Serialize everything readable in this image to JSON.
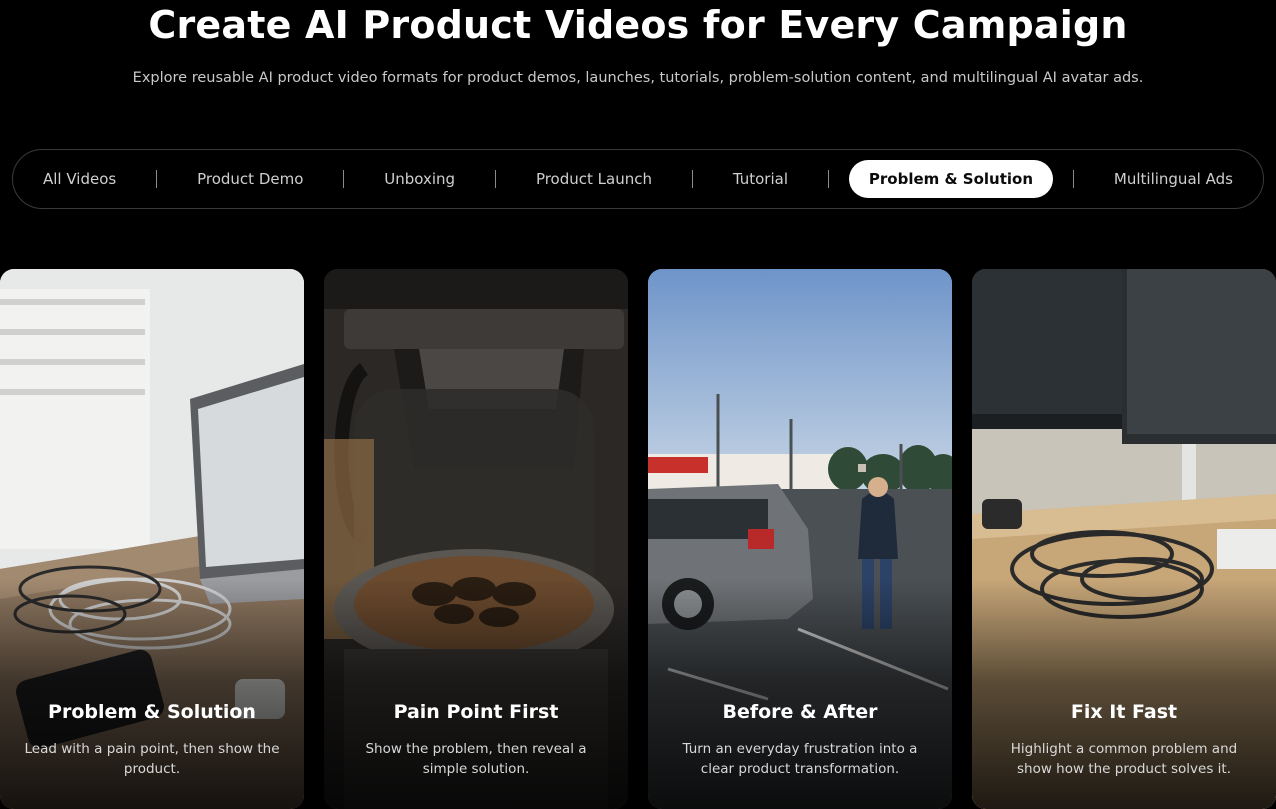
{
  "hero": {
    "title": "Create AI Product Videos for Every Campaign",
    "subtitle": "Explore reusable AI product video formats for product demos, launches, tutorials, problem-solution content, and multilingual AI avatar ads."
  },
  "tabs": [
    {
      "label": "All Videos",
      "active": false
    },
    {
      "label": "Product Demo",
      "active": false
    },
    {
      "label": "Unboxing",
      "active": false
    },
    {
      "label": "Product Launch",
      "active": false
    },
    {
      "label": "Tutorial",
      "active": false
    },
    {
      "label": "Problem & Solution",
      "active": true
    },
    {
      "label": "Multilingual Ads",
      "active": false
    }
  ],
  "cards": [
    {
      "title": "Problem & Solution",
      "description": "Lead with a pain point, then show the product."
    },
    {
      "title": "Pain Point First",
      "description": "Show the problem, then reveal a simple solution."
    },
    {
      "title": "Before & After",
      "description": "Turn an everyday frustration into a clear product transformation."
    },
    {
      "title": "Fix It Fast",
      "description": "Highlight a common problem and show how the product solves it."
    }
  ],
  "colors": {
    "background": "#000000",
    "active_tab_bg": "#ffffff",
    "active_tab_text": "#0b0b0b",
    "tab_text": "#cfcfcf",
    "tab_border": "#3a3a3a"
  }
}
